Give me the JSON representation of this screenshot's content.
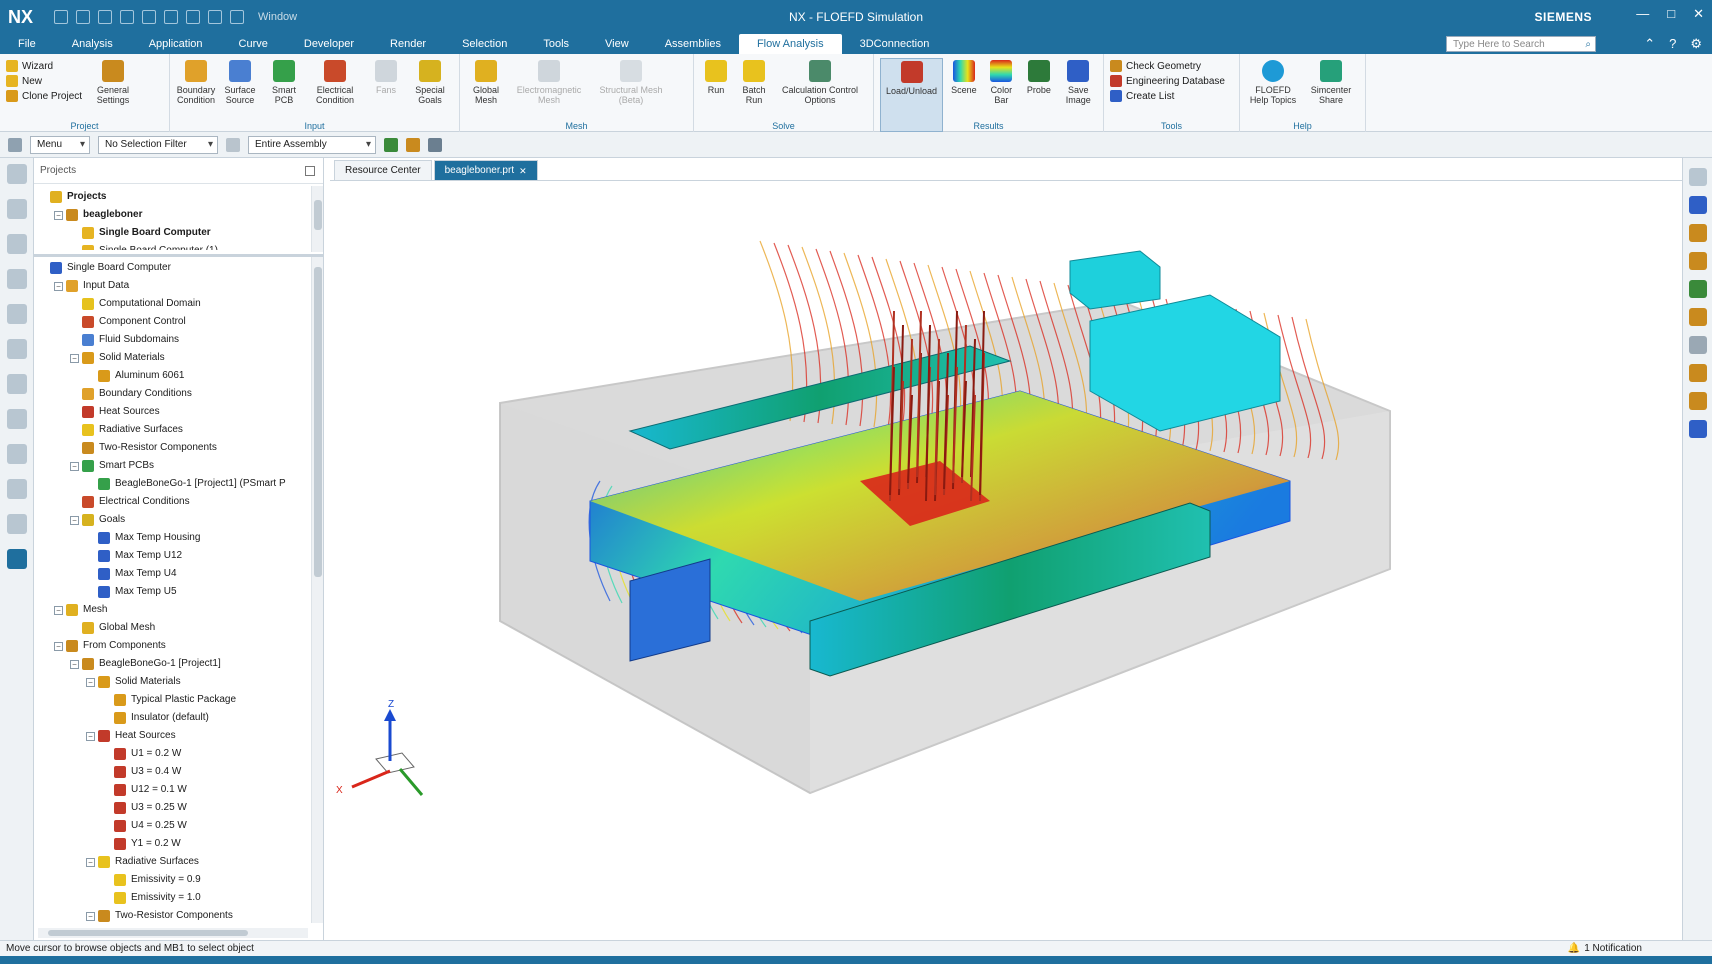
{
  "titlebar": {
    "logo": "NX",
    "window_menu": "Window",
    "title": "NX - FLOEFD Simulation",
    "brand": "SIEMENS",
    "controls": [
      "—",
      "□",
      "✕"
    ]
  },
  "menu": {
    "items": [
      "File",
      "Analysis",
      "Application",
      "Curve",
      "Developer",
      "Render",
      "Selection",
      "Tools",
      "View",
      "Assemblies",
      "Flow Analysis",
      "3DConnection"
    ],
    "active": "Flow Analysis",
    "search_placeholder": "Type Here to Search"
  },
  "ribbon": {
    "project": {
      "label": "Project",
      "list": [
        "Wizard",
        "New",
        "Clone Project"
      ],
      "buttons": [
        "General Settings"
      ]
    },
    "input": {
      "label": "Input",
      "buttons": [
        "Boundary Condition",
        "Surface Source",
        "Smart PCB",
        "Electrical Condition",
        "Fans",
        "Special Goals"
      ]
    },
    "mesh": {
      "label": "Mesh",
      "buttons": [
        "Global Mesh",
        "Electromagnetic Mesh",
        "Structural Mesh (Beta)"
      ]
    },
    "solve": {
      "label": "Solve",
      "buttons": [
        "Run",
        "Batch Run",
        "Calculation Control Options"
      ]
    },
    "results": {
      "label": "Results",
      "buttons": [
        "Load/Unload",
        "Scene",
        "Color Bar",
        "Probe",
        "Save Image"
      ]
    },
    "tools": {
      "label": "Tools",
      "list": [
        "Check Geometry",
        "Engineering Database",
        "Create List"
      ]
    },
    "help": {
      "label": "Help",
      "buttons": [
        "FLOEFD Help Topics",
        "Simcenter Share"
      ]
    }
  },
  "selection_bar": {
    "menu": "Menu",
    "filter": "No Selection Filter",
    "scope": "Entire Assembly"
  },
  "navigator": {
    "title": "Projects",
    "top_tree": [
      {
        "label": "Projects",
        "depth": 0,
        "toggle": "",
        "icon": "folder-icon",
        "bold": true
      },
      {
        "label": "beagleboner",
        "depth": 1,
        "toggle": "−",
        "icon": "project-icon",
        "bold": true
      },
      {
        "label": "Single Board Computer",
        "depth": 2,
        "toggle": "",
        "icon": "config-icon",
        "bold": true
      },
      {
        "label": "Single Board Computer (1)",
        "depth": 2,
        "toggle": "",
        "icon": "config-icon",
        "bold": false
      }
    ],
    "analysis_tree": [
      {
        "label": "Single Board Computer",
        "depth": 0,
        "toggle": "",
        "icon": "analysis-icon",
        "bold": false
      },
      {
        "label": "Input Data",
        "depth": 1,
        "toggle": "−",
        "icon": "input-data-icon",
        "bold": false
      },
      {
        "label": "Computational Domain",
        "depth": 2,
        "toggle": "",
        "icon": "domain-icon",
        "bold": false
      },
      {
        "label": "Component Control",
        "depth": 2,
        "toggle": "",
        "icon": "component-icon",
        "bold": false
      },
      {
        "label": "Fluid Subdomains",
        "depth": 2,
        "toggle": "",
        "icon": "fluid-icon",
        "bold": false
      },
      {
        "label": "Solid Materials",
        "depth": 2,
        "toggle": "−",
        "icon": "material-icon",
        "bold": false
      },
      {
        "label": "Aluminum 6061",
        "depth": 3,
        "toggle": "",
        "icon": "material-icon",
        "bold": false
      },
      {
        "label": "Boundary Conditions",
        "depth": 2,
        "toggle": "",
        "icon": "boundary-icon",
        "bold": false
      },
      {
        "label": "Heat Sources",
        "depth": 2,
        "toggle": "",
        "icon": "heat-icon",
        "bold": false
      },
      {
        "label": "Radiative Surfaces",
        "depth": 2,
        "toggle": "",
        "icon": "radiative-icon",
        "bold": false
      },
      {
        "label": "Two-Resistor Components",
        "depth": 2,
        "toggle": "",
        "icon": "resistor-icon",
        "bold": false
      },
      {
        "label": "Smart PCBs",
        "depth": 2,
        "toggle": "−",
        "icon": "pcb-icon",
        "bold": false
      },
      {
        "label": "BeagleBoneGo-1 [Project1] (PSmart P",
        "depth": 3,
        "toggle": "",
        "icon": "pcb-icon",
        "bold": false
      },
      {
        "label": "Electrical Conditions",
        "depth": 2,
        "toggle": "",
        "icon": "electrical-icon",
        "bold": false
      },
      {
        "label": "Goals",
        "depth": 2,
        "toggle": "−",
        "icon": "goals-icon",
        "bold": false
      },
      {
        "label": "Max Temp Housing",
        "depth": 3,
        "toggle": "",
        "icon": "goal-icon",
        "bold": false
      },
      {
        "label": "Max Temp U12",
        "depth": 3,
        "toggle": "",
        "icon": "goal-icon",
        "bold": false
      },
      {
        "label": "Max Temp U4",
        "depth": 3,
        "toggle": "",
        "icon": "goal-icon",
        "bold": false
      },
      {
        "label": "Max Temp U5",
        "depth": 3,
        "toggle": "",
        "icon": "goal-icon",
        "bold": false
      },
      {
        "label": "Mesh",
        "depth": 1,
        "toggle": "−",
        "icon": "mesh-icon",
        "bold": false
      },
      {
        "label": "Global Mesh",
        "depth": 2,
        "toggle": "",
        "icon": "mesh-icon",
        "bold": false
      },
      {
        "label": "From Components",
        "depth": 1,
        "toggle": "−",
        "icon": "components-icon",
        "bold": false
      },
      {
        "label": "BeagleBoneGo-1 [Project1]",
        "depth": 2,
        "toggle": "−",
        "icon": "components-icon",
        "bold": false
      },
      {
        "label": "Solid Materials",
        "depth": 3,
        "toggle": "−",
        "icon": "material-icon",
        "bold": false
      },
      {
        "label": "Typical Plastic Package",
        "depth": 4,
        "toggle": "",
        "icon": "material-icon",
        "bold": false
      },
      {
        "label": "Insulator (default)",
        "depth": 4,
        "toggle": "",
        "icon": "material-icon",
        "bold": false
      },
      {
        "label": "Heat Sources",
        "depth": 3,
        "toggle": "−",
        "icon": "heat-icon",
        "bold": false
      },
      {
        "label": "U1 = 0.2 W",
        "depth": 4,
        "toggle": "",
        "icon": "heat-icon",
        "bold": false
      },
      {
        "label": "U3 = 0.4 W",
        "depth": 4,
        "toggle": "",
        "icon": "heat-icon",
        "bold": false
      },
      {
        "label": "U12 = 0.1 W",
        "depth": 4,
        "toggle": "",
        "icon": "heat-icon",
        "bold": false
      },
      {
        "label": "U3 = 0.25 W",
        "depth": 4,
        "toggle": "",
        "icon": "heat-icon",
        "bold": false
      },
      {
        "label": "U4 = 0.25 W",
        "depth": 4,
        "toggle": "",
        "icon": "heat-icon",
        "bold": false
      },
      {
        "label": "Y1 = 0.2 W",
        "depth": 4,
        "toggle": "",
        "icon": "heat-icon",
        "bold": false
      },
      {
        "label": "Radiative Surfaces",
        "depth": 3,
        "toggle": "−",
        "icon": "radiative-icon",
        "bold": false
      },
      {
        "label": "Emissivity = 0.9",
        "depth": 4,
        "toggle": "",
        "icon": "radiative-icon",
        "bold": false
      },
      {
        "label": "Emissivity = 1.0",
        "depth": 4,
        "toggle": "",
        "icon": "radiative-icon",
        "bold": false
      },
      {
        "label": "Two-Resistor Components",
        "depth": 3,
        "toggle": "−",
        "icon": "resistor-icon",
        "bold": false
      }
    ]
  },
  "tabs": [
    {
      "label": "Resource Center",
      "active": false
    },
    {
      "label": "beagleboner.prt",
      "active": true
    }
  ],
  "axes": {
    "z": "Z",
    "x": "X"
  },
  "status": {
    "text": "Move cursor to browse objects and MB1 to select object",
    "notifications": "1 Notification"
  },
  "colors": {
    "accent": "#1f6f9e",
    "flow_cold": "#1a55e0",
    "flow_mid": "#2fd9b0",
    "flow_warm": "#e8e21a",
    "flow_hot": "#d9261a"
  }
}
